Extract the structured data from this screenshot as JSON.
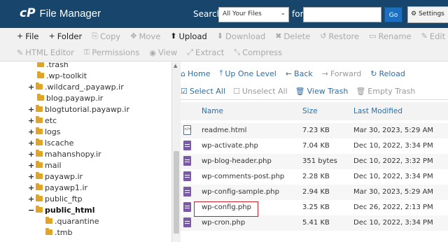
{
  "header": {
    "logo": "cP",
    "title": "File Manager",
    "search_label": "Search",
    "search_scope": "All Your Files",
    "for_label": "for",
    "search_value": "",
    "go_label": "Go",
    "settings_label": "Settings"
  },
  "toolbar": {
    "row1": [
      {
        "label": "File",
        "icon": "plus-icon",
        "glyph": "+",
        "enabled": true
      },
      {
        "label": "Folder",
        "icon": "plus-icon",
        "glyph": "+",
        "enabled": true
      },
      {
        "label": "Copy",
        "icon": "copy-icon",
        "glyph": "⎘",
        "enabled": false
      },
      {
        "label": "Move",
        "icon": "move-icon",
        "glyph": "✥",
        "enabled": false
      },
      {
        "label": "Upload",
        "icon": "upload-icon",
        "glyph": "⬆",
        "enabled": true
      },
      {
        "label": "Download",
        "icon": "download-icon",
        "glyph": "⬇",
        "enabled": false
      },
      {
        "label": "Delete",
        "icon": "delete-icon",
        "glyph": "✖",
        "enabled": false
      },
      {
        "label": "Restore",
        "icon": "restore-icon",
        "glyph": "↺",
        "enabled": false
      },
      {
        "label": "Rename",
        "icon": "rename-icon",
        "glyph": "▭",
        "enabled": false
      },
      {
        "label": "Edit",
        "icon": "edit-icon",
        "glyph": "✎",
        "enabled": false
      }
    ],
    "row2": [
      {
        "label": "HTML Editor",
        "icon": "html-editor-icon",
        "glyph": "✎",
        "enabled": false
      },
      {
        "label": "Permissions",
        "icon": "key-icon",
        "glyph": "⚿",
        "enabled": false
      },
      {
        "label": "View",
        "icon": "eye-icon",
        "glyph": "◉",
        "enabled": false
      },
      {
        "label": "Extract",
        "icon": "extract-icon",
        "glyph": "⤢",
        "enabled": false
      },
      {
        "label": "Compress",
        "icon": "compress-icon",
        "glyph": "⤡",
        "enabled": false
      }
    ]
  },
  "tree": [
    {
      "label": ".trash",
      "expander": "",
      "bold": false
    },
    {
      "label": ".wp-toolkit",
      "expander": "",
      "bold": false
    },
    {
      "label": ".wildcard_.payawp.ir",
      "expander": "+",
      "bold": false
    },
    {
      "label": "blog.payawp.ir",
      "expander": "",
      "bold": false
    },
    {
      "label": "blogtutorial.payawp.ir",
      "expander": "+",
      "bold": false
    },
    {
      "label": "etc",
      "expander": "+",
      "bold": false
    },
    {
      "label": "logs",
      "expander": "+",
      "bold": false
    },
    {
      "label": "lscache",
      "expander": "+",
      "bold": false
    },
    {
      "label": "mahanshopy.ir",
      "expander": "+",
      "bold": false
    },
    {
      "label": "mail",
      "expander": "+",
      "bold": false
    },
    {
      "label": "payawp.ir",
      "expander": "+",
      "bold": false
    },
    {
      "label": "payawp1.ir",
      "expander": "+",
      "bold": false
    },
    {
      "label": "public_ftp",
      "expander": "+",
      "bold": false
    },
    {
      "label": "public_html",
      "expander": "−",
      "bold": true
    },
    {
      "label": ".quarantine",
      "expander": "",
      "bold": false
    },
    {
      "label": ".tmb",
      "expander": "",
      "bold": false
    }
  ],
  "nav": {
    "home": "Home",
    "up_one_level": "Up One Level",
    "back": "Back",
    "forward": "Forward",
    "reload": "Reload",
    "select_all": "Select All",
    "unselect_all": "Unselect All",
    "view_trash": "View Trash",
    "empty_trash": "Empty Trash"
  },
  "table": {
    "columns": [
      "Name",
      "Size",
      "Last Modified"
    ],
    "rows": [
      {
        "name": "readme.html",
        "size": "7.23 KB",
        "modified": "Mar 30, 2023, 5:29 AM",
        "type": "html"
      },
      {
        "name": "wp-activate.php",
        "size": "7.04 KB",
        "modified": "Dec 10, 2022, 3:34 PM",
        "type": "php"
      },
      {
        "name": "wp-blog-header.php",
        "size": "351 bytes",
        "modified": "Dec 10, 2022, 3:32 PM",
        "type": "php"
      },
      {
        "name": "wp-comments-post.php",
        "size": "2.28 KB",
        "modified": "Dec 10, 2022, 3:34 PM",
        "type": "php"
      },
      {
        "name": "wp-config-sample.php",
        "size": "2.94 KB",
        "modified": "Mar 30, 2023, 5:29 AM",
        "type": "php"
      },
      {
        "name": "wp-config.php",
        "size": "3.25 KB",
        "modified": "Dec 26, 2022, 2:13 PM",
        "type": "php"
      },
      {
        "name": "wp-cron.php",
        "size": "5.41 KB",
        "modified": "Dec 10, 2022, 3:34 PM",
        "type": "php"
      }
    ]
  },
  "colors": {
    "header_bg": "#17456b",
    "link": "#2d6ea5",
    "highlight": "#d0202a",
    "folder": "#e0a526",
    "php_icon": "#7b5aa6"
  }
}
